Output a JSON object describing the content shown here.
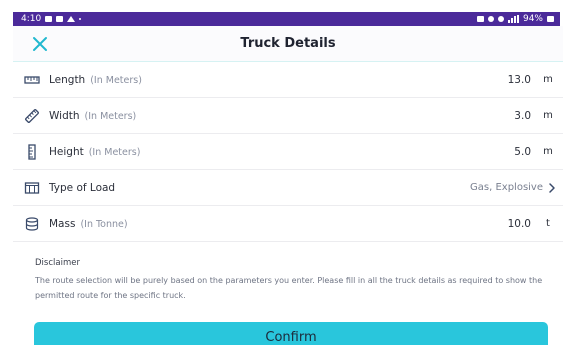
{
  "status_bar": {
    "time": "4:10",
    "battery": "94%"
  },
  "header": {
    "title": "Truck Details",
    "close_icon": "close-icon"
  },
  "rows": [
    {
      "icon": "ruler-icon",
      "label": "Length",
      "hint": "(In Meters)",
      "value": "13.0",
      "unit": "m"
    },
    {
      "icon": "width-ruler-icon",
      "label": "Width",
      "hint": "(In Meters)",
      "value": "3.0",
      "unit": "m"
    },
    {
      "icon": "height-ruler-icon",
      "label": "Height",
      "hint": "(In Meters)",
      "value": "5.0",
      "unit": "m"
    },
    {
      "icon": "cargo-icon",
      "label": "Type of Load",
      "value": "Gas, Explosive"
    },
    {
      "icon": "weight-icon",
      "label": "Mass",
      "hint": "(In Tonne)",
      "value": "10.0",
      "unit": "t"
    }
  ],
  "disclaimer": {
    "title": "Disclaimer",
    "text": "The route selection will be purely based on the parameters you enter. Please fill in all the truck details as required to show the permitted route for the specific truck."
  },
  "confirm": {
    "label": "Confirm"
  },
  "colors": {
    "status_bar": "#4b2a9a",
    "accent": "#29c6dc",
    "close_icon": "#21b8cf"
  }
}
